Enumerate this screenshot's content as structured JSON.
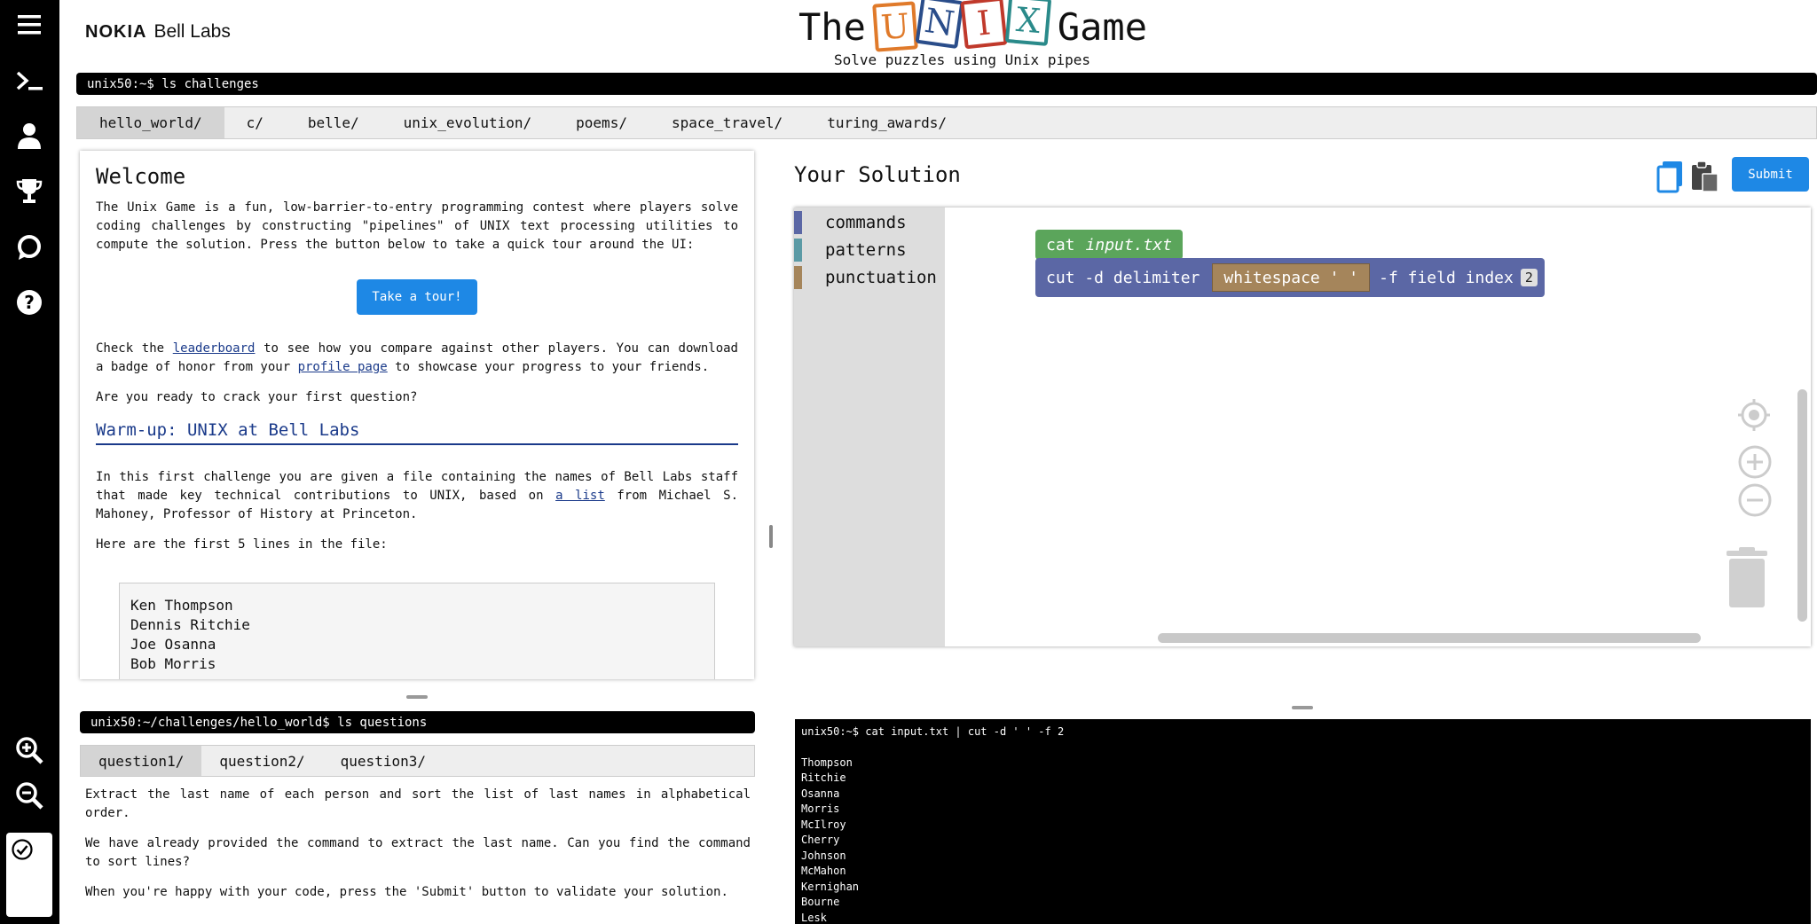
{
  "header": {
    "brand_nokia": "NOKIA",
    "brand_bell": "Bell Labs",
    "title_pre": "The",
    "tiles": [
      {
        "letter": "U",
        "color": "#e07a2a"
      },
      {
        "letter": "N",
        "color": "#2a4d8a"
      },
      {
        "letter": "I",
        "color": "#c0392b"
      },
      {
        "letter": "X",
        "color": "#2a8a8a"
      }
    ],
    "title_post": "Game",
    "subtitle": "Solve puzzles using Unix pipes"
  },
  "sidebar": {
    "icons": [
      "menu-icon",
      "terminal-icon",
      "user-icon",
      "trophy-icon",
      "chat-icon",
      "help-icon",
      "zoom-in-icon",
      "zoom-out-icon",
      "checklist-icon"
    ]
  },
  "challenges": {
    "prompt": "unix50:~$ ls challenges",
    "tabs": [
      "hello_world/",
      "c/",
      "belle/",
      "unix_evolution/",
      "poems/",
      "space_travel/",
      "turing_awards/"
    ],
    "active_tab": "hello_world/"
  },
  "content": {
    "welcome_title": "Welcome",
    "intro": "The Unix Game is a fun, low-barrier-to-entry programming contest where players solve coding challenges by constructing \"pipelines\" of UNIX text processing utilities to compute the solution. Press the button below to take a quick tour around the UI:",
    "tour_button": "Take a tour!",
    "check_pre": "Check the ",
    "leaderboard_link": "leaderboard",
    "check_mid": " to see how you compare against other players. You can download a badge of honor from your ",
    "profile_link": "profile page",
    "check_post": " to showcase your progress to your friends.",
    "ready": "Are you ready to crack your first question?",
    "warmup_title": "Warm-up: UNIX at Bell Labs",
    "challenge_pre": "In this first challenge you are given a file containing the names of Bell Labs staff that made key technical contributions to UNIX, based on ",
    "list_link": "a list",
    "challenge_post": " from Michael S. Mahoney, Professor of History at Princeton.",
    "first_lines_label": "Here are the first 5 lines in the file:",
    "file_lines": [
      "Ken Thompson",
      "Dennis Ritchie",
      "Joe Osanna",
      "Bob Morris"
    ]
  },
  "questions": {
    "prompt": "unix50:~/challenges/hello_world$ ls questions",
    "tabs": [
      "question1/",
      "question2/",
      "question3/"
    ],
    "active_tab": "question1/",
    "text": [
      "Extract the last name of each person and sort the list of last names in alphabetical order.",
      "We have already provided the command to extract the last name. Can you find the command to sort lines?",
      "When you're happy with your code, press the 'Submit' button to validate your solution."
    ]
  },
  "solution": {
    "title": "Your Solution",
    "submit": "Submit",
    "categories": [
      {
        "label": "commands",
        "color": "#5b67a5"
      },
      {
        "label": "patterns",
        "color": "#5b9aa5"
      },
      {
        "label": "punctuation",
        "color": "#a5855b"
      }
    ],
    "blocks": {
      "cat_cmd": "cat",
      "cat_file": "input.txt",
      "cut_cmd": "cut -d delimiter",
      "whitespace": "whitespace ' '",
      "field_label": "-f field index",
      "field_index": "2"
    }
  },
  "output": {
    "command": "unix50:~$ cat input.txt | cut -d ' ' -f 2",
    "lines": [
      "Thompson",
      "Ritchie",
      "Osanna",
      "Morris",
      "McIlroy",
      "Cherry",
      "Johnson",
      "McMahon",
      "Kernighan",
      "Bourne",
      "Lesk"
    ]
  }
}
